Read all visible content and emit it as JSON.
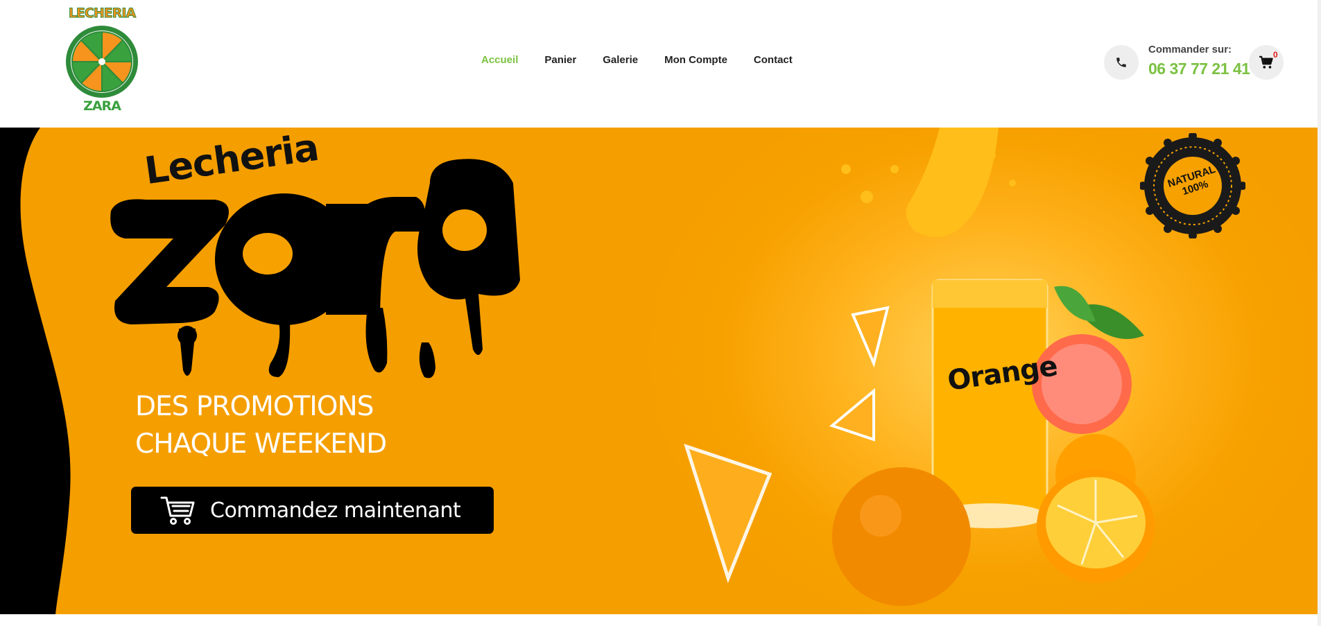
{
  "logo": {
    "top_text": "LECHERIA",
    "bottom_text": "ZARA"
  },
  "nav": {
    "items": [
      {
        "label": "Accueil",
        "active": true
      },
      {
        "label": "Panier",
        "active": false
      },
      {
        "label": "Galerie",
        "active": false
      },
      {
        "label": "Mon Compte",
        "active": false
      },
      {
        "label": "Contact",
        "active": false
      }
    ]
  },
  "contact": {
    "label": "Commander sur:",
    "phone": "06 37 77 21 41",
    "phone_icon": "phone-icon"
  },
  "cart": {
    "count": "0",
    "icon": "cart-icon"
  },
  "hero": {
    "brand_small": "Lecheria",
    "brand_big": "zara",
    "promo_line1": "DES PROMOTIONS",
    "promo_line2": "CHAQUE WEEKEND",
    "cta_label": "Commandez maintenant",
    "cta_icon": "cart-icon",
    "seal_line1": "NATURAL",
    "seal_line2": "100%",
    "glass_label": "Orange"
  },
  "colors": {
    "accent_green": "#7bc142",
    "hero_orange": "#f7a100",
    "badge_red": "#e01b1b"
  }
}
